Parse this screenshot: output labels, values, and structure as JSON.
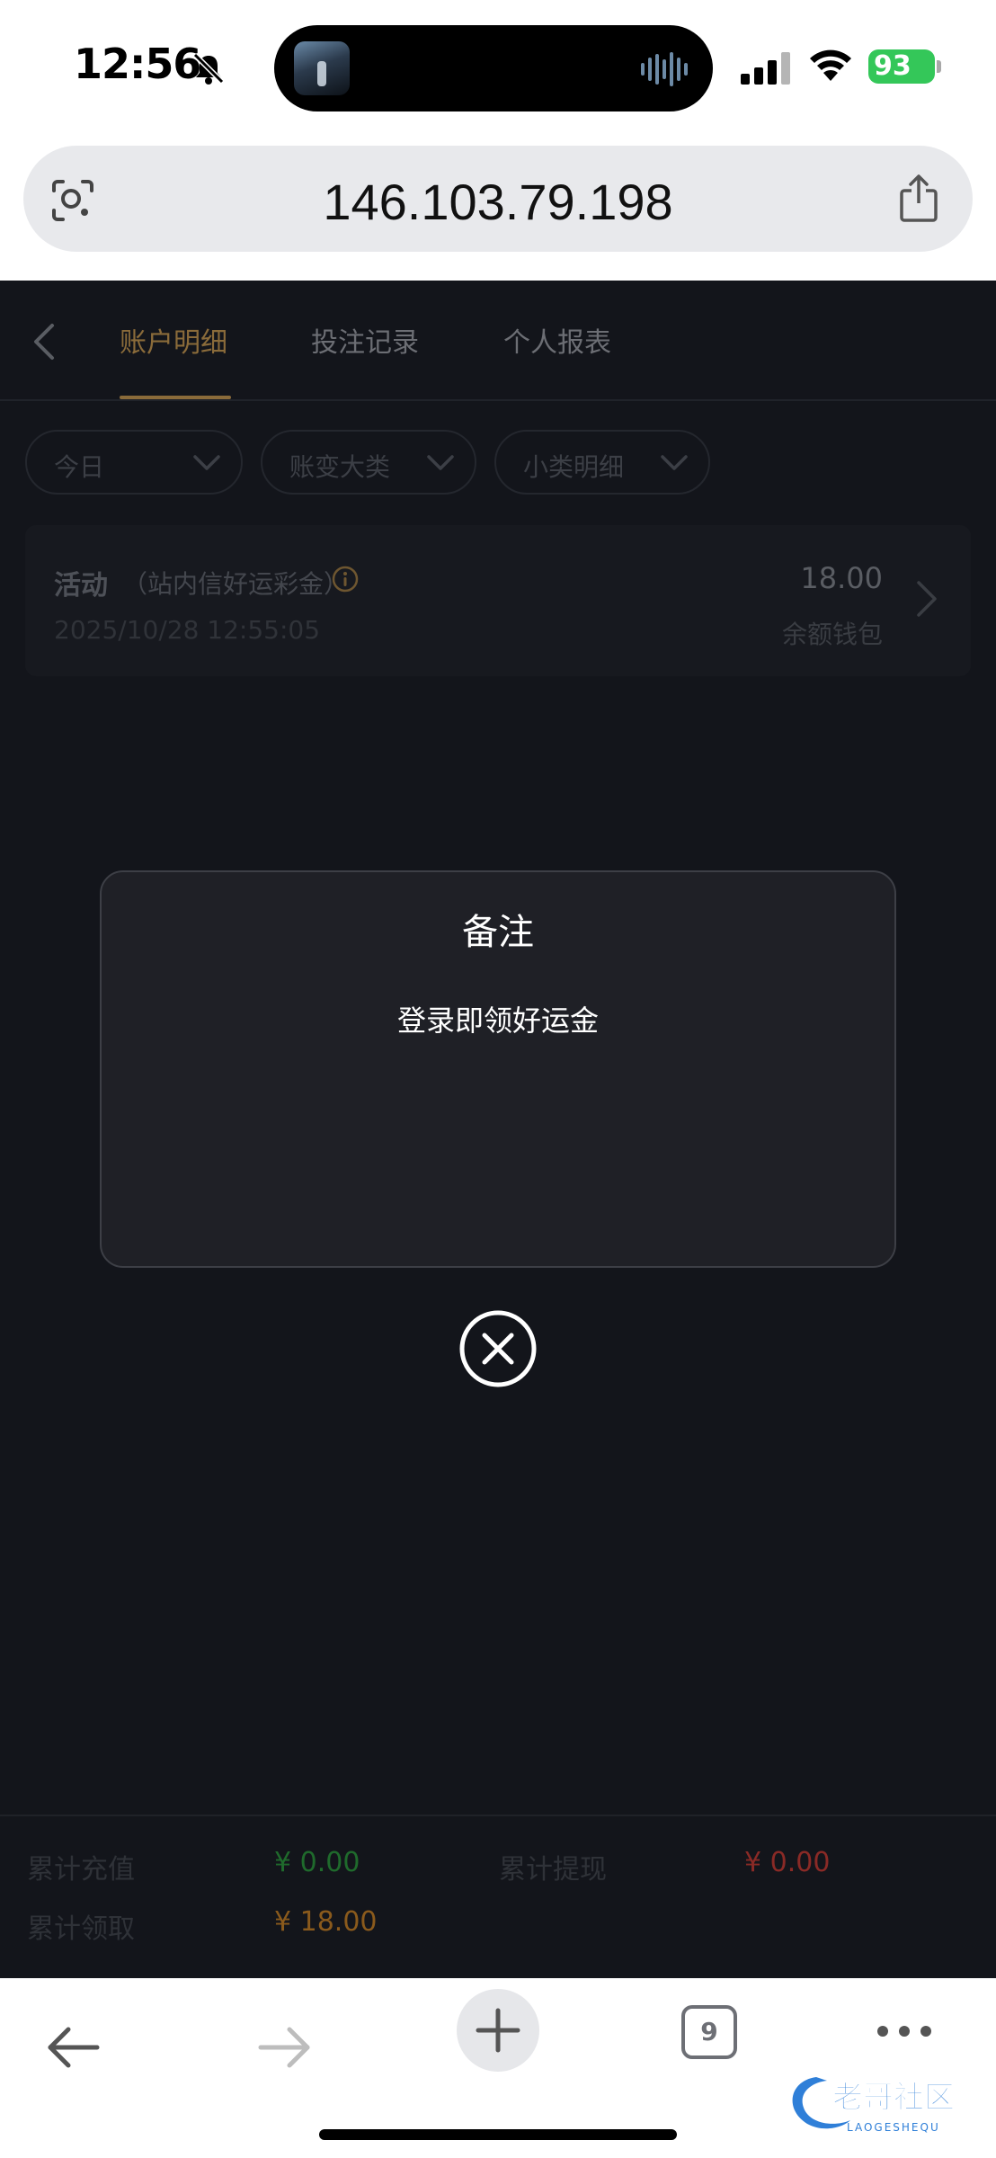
{
  "status": {
    "time": "12:56",
    "battery": "93"
  },
  "browser": {
    "url": "146.103.79.198",
    "tab_count": "9"
  },
  "tabs": [
    {
      "label": "账户明细",
      "active": true
    },
    {
      "label": "投注记录",
      "active": false
    },
    {
      "label": "个人报表",
      "active": false
    }
  ],
  "filters": [
    {
      "label": "今日"
    },
    {
      "label": "账变大类"
    },
    {
      "label": "小类明细"
    }
  ],
  "record": {
    "title": "活动",
    "subtitle": "（站内信好运彩金）",
    "date": "2025/10/28 12:55:05",
    "amount": "18.00",
    "wallet": "余额钱包"
  },
  "summary": {
    "recharge_label": "累计充值",
    "recharge_value": "¥ 0.00",
    "withdraw_label": "累计提现",
    "withdraw_value": "¥ 0.00",
    "claimed_label": "累计领取",
    "claimed_value": "¥ 18.00"
  },
  "modal": {
    "title": "备注",
    "body": "登录即领好运金"
  },
  "watermark": {
    "text": "老哥社区",
    "subtext": "LAOGESHEQU"
  },
  "colors": {
    "accent": "#8a6b3a",
    "recharge": "#1f6a2c",
    "withdraw": "#8a2a26",
    "claimed": "#8a5a1c"
  }
}
